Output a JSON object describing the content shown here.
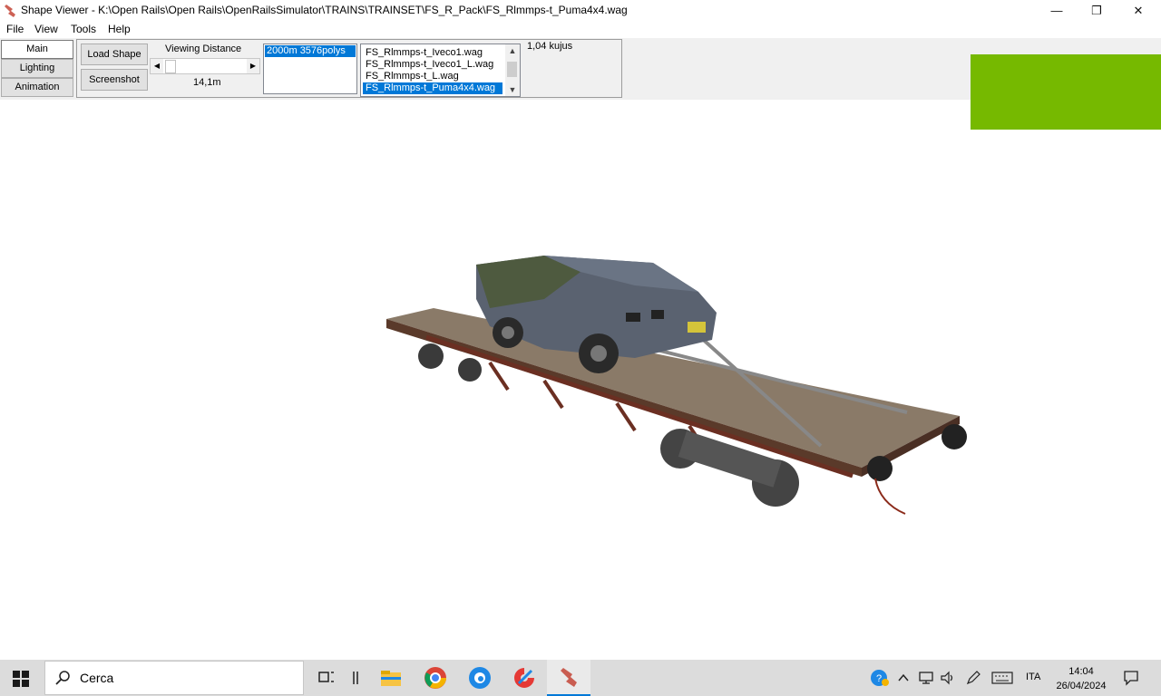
{
  "window": {
    "title": "Shape Viewer - K:\\Open Rails\\Open Rails\\OpenRailsSimulator\\TRAINS\\TRAINSET\\FS_R_Pack\\FS_Rlmmps-t_Puma4x4.wag",
    "minimize": "—",
    "maximize": "❐",
    "close": "✕"
  },
  "menu": [
    "File",
    "View",
    "Tools",
    "Help"
  ],
  "tabs": [
    "Main",
    "Lighting",
    "Animation"
  ],
  "toolbar": {
    "load_shape": "Load Shape",
    "screenshot": "Screenshot",
    "viewing_distance_label": "Viewing Distance",
    "viewing_distance_value": "14,1m",
    "lod_items": [
      "2000m 3576polys"
    ],
    "files": [
      "FS_Rlmmps-t_Iveco1.wag",
      "FS_Rlmmps-t_Iveco1_L.wag",
      "FS_Rlmmps-t_L.wag",
      "FS_Rlmmps-t_Puma4x4.wag"
    ],
    "selected_file": "FS_Rlmmps-t_Puma4x4.wag",
    "count_label": "1,04 kujus"
  },
  "taskbar": {
    "search_placeholder": "Cerca",
    "lang": "ITA",
    "time": "14:04",
    "date": "26/04/2024"
  },
  "colors": {
    "accent": "#0078d7",
    "green_square": "#76b900"
  }
}
